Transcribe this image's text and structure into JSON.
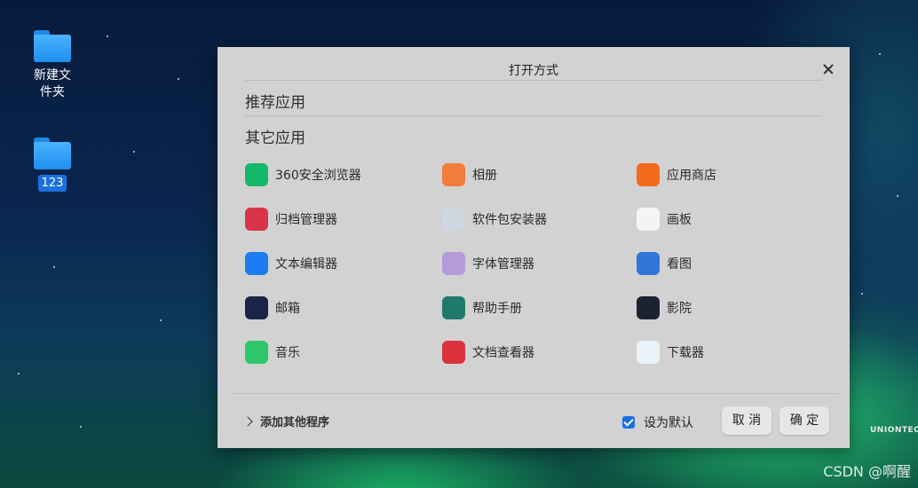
{
  "desktop": {
    "icons": [
      {
        "label_line1": "新建文",
        "label_line2": "件夹"
      },
      {
        "label": "123"
      }
    ]
  },
  "dialog": {
    "title": "打开方式",
    "recommended_heading": "推荐应用",
    "other_heading": "其它应用",
    "apps": [
      {
        "name": "360安全浏览器",
        "icon": "browser-360-icon",
        "color": "#15b86a"
      },
      {
        "name": "相册",
        "icon": "album-icon",
        "color": "#f07d3a"
      },
      {
        "name": "应用商店",
        "icon": "app-store-icon",
        "color": "#f26b1d"
      },
      {
        "name": "归档管理器",
        "icon": "archive-manager-icon",
        "color": "#d8344a"
      },
      {
        "name": "软件包安装器",
        "icon": "package-installer-icon",
        "color": "#cfd7e0"
      },
      {
        "name": "画板",
        "icon": "draw-board-icon",
        "color": "#f4f4f4"
      },
      {
        "name": "文本编辑器",
        "icon": "text-editor-icon",
        "color": "#1d7cf0"
      },
      {
        "name": "字体管理器",
        "icon": "font-manager-icon",
        "color": "#b79ad8"
      },
      {
        "name": "看图",
        "icon": "image-viewer-icon",
        "color": "#3176d9"
      },
      {
        "name": "邮箱",
        "icon": "mail-icon",
        "color": "#1a2448"
      },
      {
        "name": "帮助手册",
        "icon": "help-manual-icon",
        "color": "#1f7a6b"
      },
      {
        "name": "影院",
        "icon": "movie-icon",
        "color": "#1c2330"
      },
      {
        "name": "音乐",
        "icon": "music-icon",
        "color": "#2cc76a"
      },
      {
        "name": "文档查看器",
        "icon": "document-viewer-icon",
        "color": "#d9323d"
      },
      {
        "name": "下载器",
        "icon": "downloader-icon",
        "color": "#e9f3f8"
      }
    ],
    "add_other_label": "添加其他程序",
    "set_default_label": "设为默认",
    "set_default_checked": true,
    "cancel_label": "取 消",
    "confirm_label": "确 定"
  },
  "brand_text": "UNIONTEC",
  "watermark": "CSDN @啊醒"
}
